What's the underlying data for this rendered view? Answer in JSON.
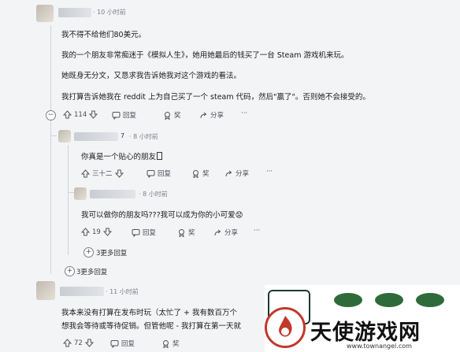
{
  "comment1": {
    "username": "",
    "time": "· 10 小时前",
    "paragraphs": [
      "我不得不给他们80美元。",
      "我的一个朋友非常痴迷于《模拟人生》，她用她最后的钱买了一台 Steam 游戏机来玩。",
      "她既身无分文，又恳求我告诉她我对这个游戏的看法。",
      "我打算告诉她我在 reddit 上为自己买了一个 steam 代码，然后\"赢了\"。否则她不会接受的。"
    ],
    "votes": "114",
    "reply": "回复",
    "award": "奖",
    "share": "分享",
    "more": "···"
  },
  "reply1": {
    "username_tail": "7",
    "time": "· 8 小时前",
    "text": "你真是一个贴心的朋友",
    "votes": "三十二",
    "reply": "回复",
    "award": "奖",
    "share": "分享",
    "more": "···"
  },
  "reply2": {
    "time": "· 8 小时前",
    "text": "我可以做你的朋友吗???我可以成为你的小可爱",
    "emoji": "😟",
    "votes": "19",
    "reply": "回复",
    "award": "奖",
    "share": "分享",
    "more": "···"
  },
  "more_inner": "3更多回复",
  "more_outer": "3更多回复",
  "comment2": {
    "time": "· 11 小时前",
    "line1": "我本来没有打算在发布时玩（太忙了 + 我有数百万个",
    "line2": "想我会等待或等待促销。但管他呢 - 我打算在第一天就",
    "votes": "72",
    "reply": "回复",
    "award": "奖"
  },
  "watermark": {
    "brand": "天使游戏网",
    "url": "www.townangel.com"
  }
}
